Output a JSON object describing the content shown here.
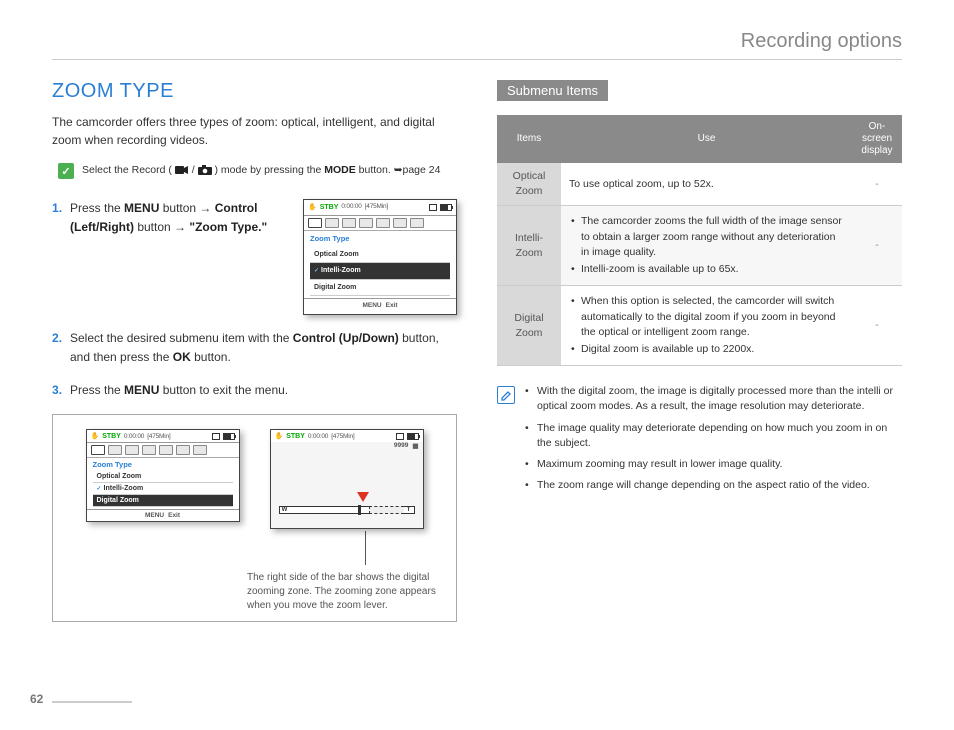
{
  "header": {
    "title": "Recording options"
  },
  "left": {
    "section_title": "ZOOM TYPE",
    "intro": "The camcorder offers three types of zoom: optical, intelligent, and digital zoom when recording videos.",
    "note": {
      "prefix": "Select the Record (",
      "sep": " / ",
      "suffix": ") mode by pressing the ",
      "bold": "MODE",
      "tail": " button. ",
      "page_ref": "page 24"
    },
    "steps": {
      "s1": {
        "t1": "Press the ",
        "b1": "MENU",
        "t2": " button ",
        "b2": "Control (Left/Right)",
        "t3": " button ",
        "b3": "\"Zoom Type.\""
      },
      "s2": {
        "t1": "Select the desired submenu item with the ",
        "b1": "Control (Up/Down)",
        "t2": " button, and then press the ",
        "b2": "OK",
        "t3": " button."
      },
      "s3": {
        "t1": "Press the ",
        "b1": "MENU",
        "t2": " button to exit the menu."
      }
    },
    "lcd": {
      "stby": "STBY",
      "time": "0:00:00",
      "remain": "[475Min]",
      "menu_title": "Zoom Type",
      "items": [
        "Optical Zoom",
        "Intelli-Zoom",
        "Digital Zoom"
      ],
      "menu_exit_label": "MENU",
      "menu_exit_text": "Exit"
    },
    "lcd_preview": {
      "counter": "9999",
      "w": "W",
      "t": "T"
    },
    "callout": "The right side of the bar shows the digital zooming zone. The zooming zone appears when you move the zoom lever."
  },
  "right": {
    "submenu_label": "Submenu Items",
    "table": {
      "headers": [
        "Items",
        "Use",
        "On-screen display"
      ],
      "rows": [
        {
          "item": "Optical Zoom",
          "use_text": "To use optical zoom, up to 52x.",
          "display": "-"
        },
        {
          "item": "Intelli-Zoom",
          "use_list": [
            "The camcorder zooms the full width of the image sensor to obtain a larger zoom range without any deterioration in image quality.",
            "Intelli-zoom is available up to 65x."
          ],
          "display": "-"
        },
        {
          "item": "Digital Zoom",
          "use_list": [
            "When this option is selected, the camcorder will switch automatically to the digital zoom if you zoom in beyond the optical or intelligent zoom range.",
            "Digital zoom is available up to 2200x."
          ],
          "display": "-"
        }
      ]
    },
    "info": [
      "With the digital zoom, the image is digitally processed more than the intelli or optical zoom modes. As a result, the image resolution may deteriorate.",
      "The image quality may deteriorate depending on how much you zoom in on the subject.",
      "Maximum zooming may result in lower image quality.",
      "The zoom range will change depending on the aspect ratio of the video."
    ]
  },
  "page_number": "62"
}
